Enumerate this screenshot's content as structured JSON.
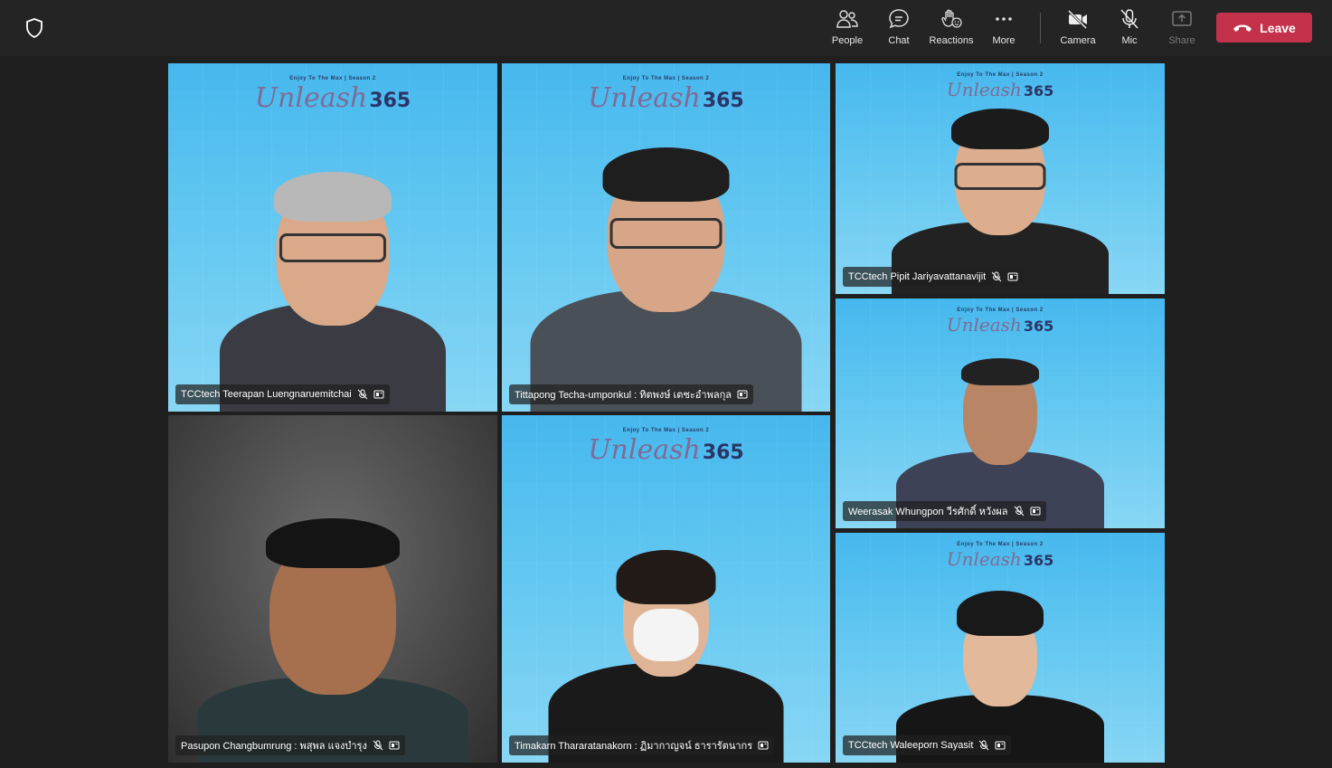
{
  "toolbar": {
    "people": "People",
    "chat": "Chat",
    "reactions": "Reactions",
    "more": "More",
    "camera": "Camera",
    "mic": "Mic",
    "share": "Share",
    "leave": "Leave"
  },
  "banner": {
    "tagline": "Enjoy To The Max | Season 2",
    "word": "Unleash",
    "number": "365"
  },
  "participants": [
    {
      "name": "TCCtech Teerapan Luengnaruemitchai"
    },
    {
      "name": "Tittapong Techa-umponkul : ทิตพงษ์ เตชะอำพลกุล"
    },
    {
      "name": "TCCtech Pipit Jariyavattanavijit"
    },
    {
      "name": "Weerasak Whungpon วีรศักดิ์ หวังผล"
    },
    {
      "name": "Pasupon Changbumrung : พสุพล แจงบำรุง"
    },
    {
      "name": "Timakarn Thararatanakorn : ฏิมากาญจน์ ธารารัตนากร"
    },
    {
      "name": "TCCtech Waleeporn Sayasit"
    }
  ],
  "colors": {
    "leave": "#c4314b",
    "topbar": "#242424",
    "stage": "#1f1f1f",
    "tile_blue": "#62c7f1"
  },
  "icons": [
    "shield-icon",
    "people-icon",
    "chat-icon",
    "reactions-icon",
    "more-icon",
    "camera-off-icon",
    "mic-off-icon",
    "share-icon",
    "phone-hangup-icon",
    "mic-muted-icon",
    "pin-icon"
  ]
}
